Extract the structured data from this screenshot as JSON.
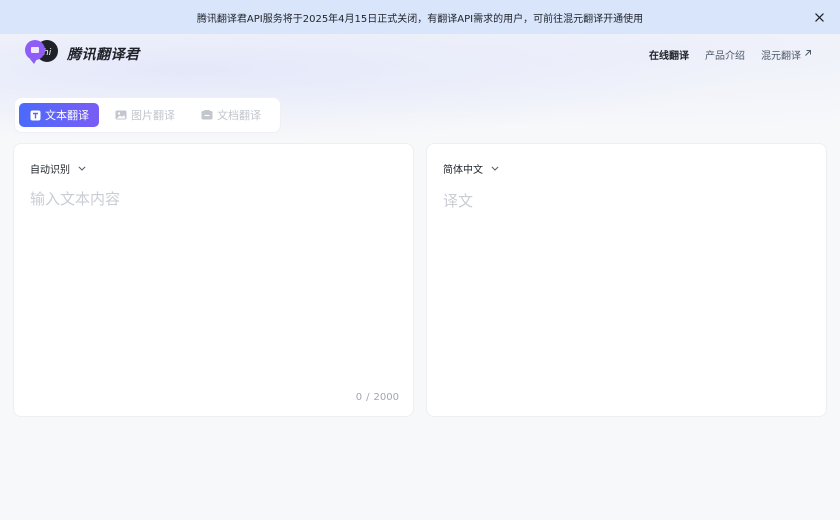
{
  "banner": {
    "message": "腾讯翻译君API服务将于2025年4月15日正式关闭，有翻译API需求的用户，可前往混元翻译开通使用",
    "close_icon": "close-icon"
  },
  "brand": {
    "name": "腾讯翻译君",
    "logo_icon": "logo-chat-bubbles-icon",
    "logo_text": "hi"
  },
  "nav": {
    "items": [
      {
        "label": "在线翻译",
        "active": true
      },
      {
        "label": "产品介绍",
        "active": false
      },
      {
        "label": "混元翻译",
        "active": false,
        "icon": "external-arrow-icon"
      }
    ]
  },
  "tabs": [
    {
      "label": "文本翻译",
      "icon": "text-icon",
      "active": true
    },
    {
      "label": "图片翻译",
      "icon": "image-icon",
      "active": false
    },
    {
      "label": "文档翻译",
      "icon": "document-icon",
      "active": false
    }
  ],
  "source_panel": {
    "language": "自动识别",
    "placeholder": "输入文本内容",
    "value": "",
    "char_count": "0",
    "separator": "/",
    "char_limit": "2000"
  },
  "target_panel": {
    "language": "简体中文",
    "placeholder": "译文"
  },
  "colors": {
    "banner_bg": "#d9e5fb",
    "tab_active_gradient_start": "#4b6bfb",
    "tab_active_gradient_end": "#7a5cf6",
    "page_bg": "#f7f8fa",
    "placeholder": "#c9cdd4"
  }
}
